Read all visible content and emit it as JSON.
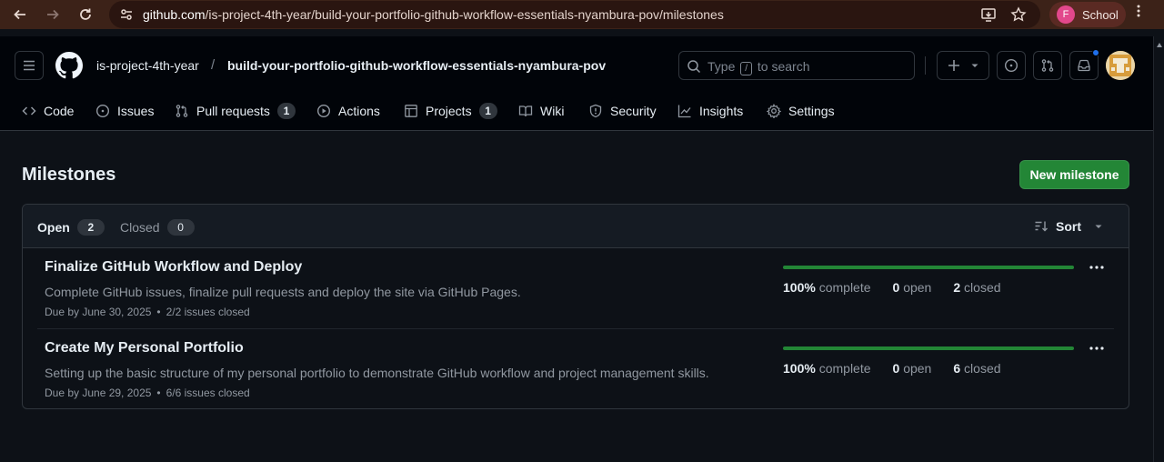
{
  "browser": {
    "url_host": "github.com",
    "url_path": "/is-project-4th-year/build-your-portfolio-github-workflow-essentials-nyambura-pov/milestones",
    "profile_initial": "F",
    "profile_name": "School"
  },
  "header": {
    "owner": "is-project-4th-year",
    "separator": "/",
    "repo": "build-your-portfolio-github-workflow-essentials-nyambura-pov",
    "search_prefix": "Type",
    "search_key": "/",
    "search_suffix": "to search"
  },
  "tabs": [
    {
      "label": "Code",
      "icon": "code-icon"
    },
    {
      "label": "Issues",
      "icon": "issue-icon"
    },
    {
      "label": "Pull requests",
      "icon": "pull-request-icon",
      "count": "1"
    },
    {
      "label": "Actions",
      "icon": "play-icon"
    },
    {
      "label": "Projects",
      "icon": "table-icon",
      "count": "1"
    },
    {
      "label": "Wiki",
      "icon": "book-icon"
    },
    {
      "label": "Security",
      "icon": "shield-icon"
    },
    {
      "label": "Insights",
      "icon": "graph-icon"
    },
    {
      "label": "Settings",
      "icon": "gear-icon"
    }
  ],
  "page": {
    "title": "Milestones",
    "new_button": "New milestone"
  },
  "filters": {
    "open_label": "Open",
    "open_count": "2",
    "closed_label": "Closed",
    "closed_count": "0",
    "sort_label": "Sort"
  },
  "milestones": [
    {
      "title": "Finalize GitHub Workflow and Deploy",
      "description": "Complete GitHub issues, finalize pull requests and deploy the site via GitHub Pages.",
      "due": "Due by June 30, 2025",
      "issues_closed": "2/2 issues closed",
      "percent": "100%",
      "percent_label": "complete",
      "open_count": "0",
      "open_label": "open",
      "closed_count": "2",
      "closed_label": "closed",
      "progress": 1.0
    },
    {
      "title": "Create My Personal Portfolio",
      "description": "Setting up the basic structure of my personal portfolio to demonstrate GitHub workflow and project management skills.",
      "due": "Due by June 29, 2025",
      "issues_closed": "6/6 issues closed",
      "percent": "100%",
      "percent_label": "complete",
      "open_count": "0",
      "open_label": "open",
      "closed_count": "6",
      "closed_label": "closed",
      "progress": 1.0
    }
  ],
  "colors": {
    "accent_green": "#238636",
    "notification_blue": "#1f6feb",
    "chrome_brown": "#3c2218"
  }
}
